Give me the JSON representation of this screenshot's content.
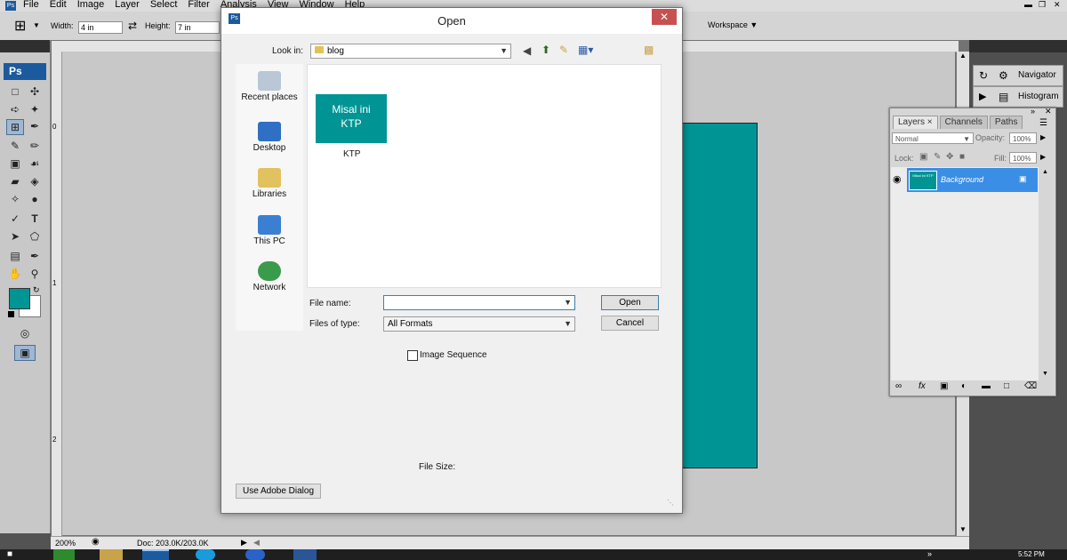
{
  "menu": [
    "File",
    "Edit",
    "Image",
    "Layer",
    "Select",
    "Filter",
    "Analysis",
    "View",
    "Window",
    "Help"
  ],
  "options_bar": {
    "width_label": "Width:",
    "width_value": "4 in",
    "height_label": "Height:",
    "height_value": "7 in",
    "workspace_label": "Workspace"
  },
  "toolbox": {
    "logo": "Ps"
  },
  "ruler": {
    "top_0": "0",
    "left_1": "1",
    "left_2": "2",
    "left_0": "0"
  },
  "status": {
    "zoom": "200%",
    "doc": "Doc: 203.0K/203.0K"
  },
  "dock": {
    "navigator": "Navigator",
    "histogram": "Histogram"
  },
  "layers_panel": {
    "tabs": [
      "Layers",
      "Channels",
      "Paths"
    ],
    "blend_mode": "Normal",
    "opacity_label": "Opacity:",
    "opacity_value": "100%",
    "lock_label": "Lock:",
    "fill_label": "Fill:",
    "fill_value": "100%",
    "layer_name": "Background",
    "thumb_text": "Misal ini KTP"
  },
  "dialog": {
    "title": "Open",
    "look_in_label": "Look in:",
    "look_in_value": "blog",
    "places": [
      "Recent places",
      "Desktop",
      "Libraries",
      "This PC",
      "Network"
    ],
    "file_thumb_line1": "Misal ini",
    "file_thumb_line2": "KTP",
    "file_name": "KTP",
    "file_name_label": "File name:",
    "file_name_value": "",
    "files_of_type_label": "Files of type:",
    "files_of_type_value": "All Formats",
    "open_button": "Open",
    "cancel_button": "Cancel",
    "image_sequence": "Image Sequence",
    "file_size_label": "File Size:",
    "adobe_dialog_button": "Use Adobe Dialog"
  },
  "taskbar": {
    "time": "5:52 PM"
  },
  "colors": {
    "teal": "#009494",
    "selection": "#3a8ee6",
    "close": "#c75050"
  }
}
